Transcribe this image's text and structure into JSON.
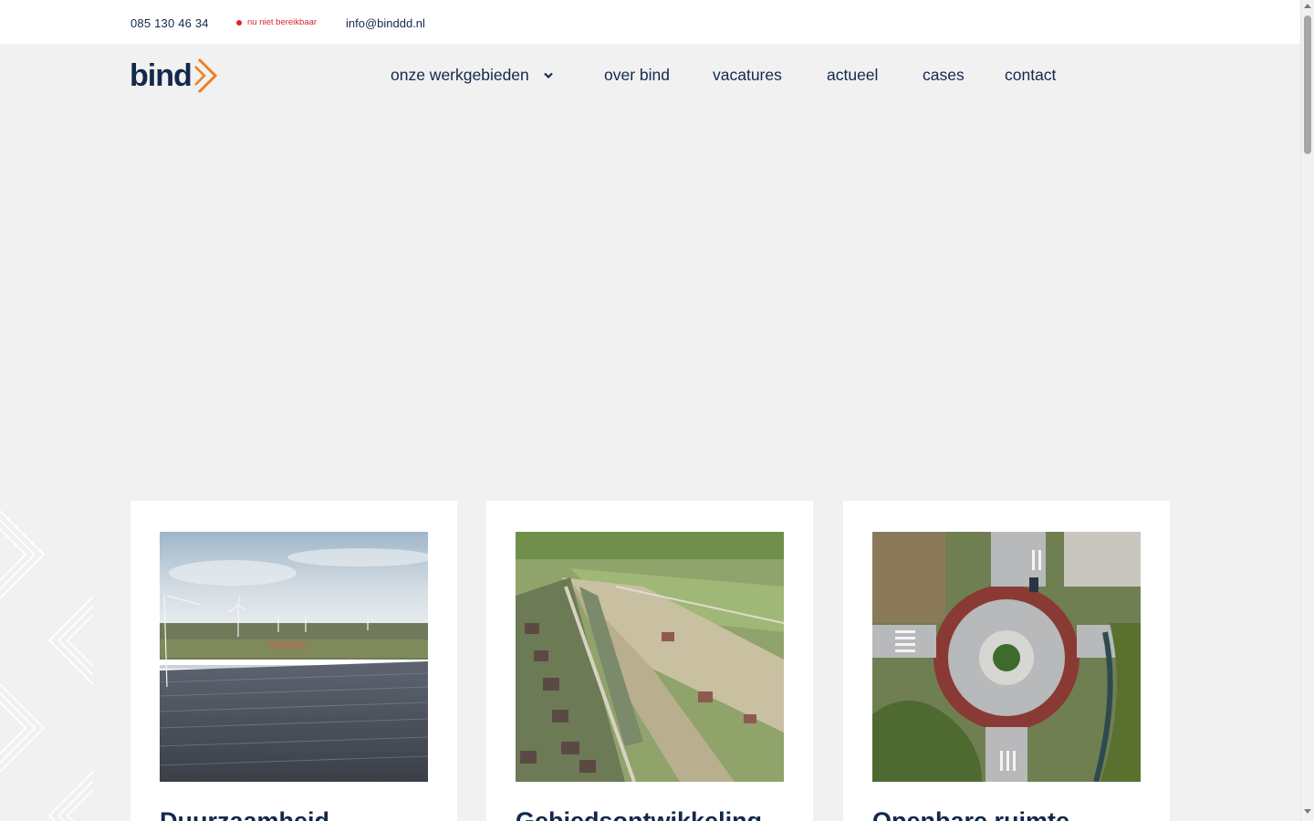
{
  "topbar": {
    "phone": "085 130 46 34",
    "status": "nu niet bereikbaar",
    "email": "info@binddd.nl"
  },
  "logo": {
    "text": "bind",
    "colors": {
      "text": "#13294b",
      "accent": "#ef7d22"
    }
  },
  "nav": {
    "items": [
      {
        "label": "onze werkgebieden",
        "has_dropdown": true
      },
      {
        "label": "over bind"
      },
      {
        "label": "vacatures"
      },
      {
        "label": "actueel"
      },
      {
        "label": "cases"
      },
      {
        "label": "contact"
      }
    ]
  },
  "cards": [
    {
      "title": "Duurzaamheid",
      "image": "wind turbines and solar park aerial photo"
    },
    {
      "title": "Gebiedsontwikkeling",
      "image": "aerial photo of new residential development"
    },
    {
      "title": "Openbare ruimte",
      "image": "aerial photo of roundabout"
    }
  ],
  "colors": {
    "brand_navy": "#13294b",
    "brand_orange": "#ef7d22",
    "status_red": "#d8262b",
    "page_bg": "#f1f1f1"
  }
}
